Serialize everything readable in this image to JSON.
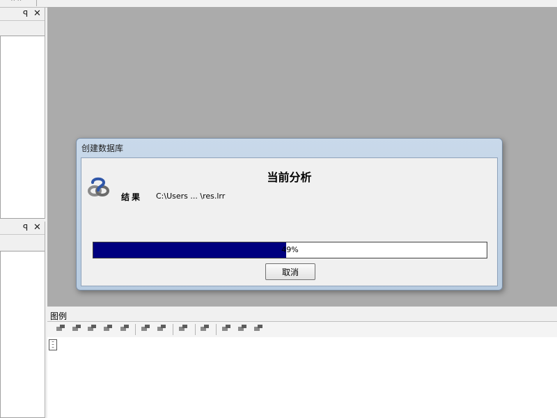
{
  "dialog": {
    "title": "创建数据库",
    "heading": "当前分析",
    "result_label": "结果",
    "result_value": "C:\\Users ... \\res.lrr",
    "progress_percent": 49,
    "progress_text": "49%",
    "cancel_label": "取消"
  },
  "legend": {
    "title": "图例"
  },
  "colors": {
    "workarea": "#ababab",
    "progress_fill": "#00007f",
    "dialog_frame": "#b7cbe0"
  },
  "icons": {
    "app": "lumerical-logo-icon",
    "pin": "pin-icon",
    "close": "close-icon",
    "legend_item": "legend-list-icon"
  }
}
